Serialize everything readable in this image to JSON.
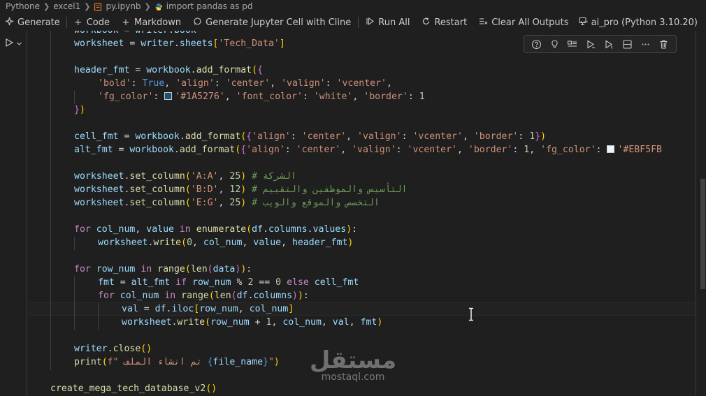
{
  "breadcrumb": {
    "items": [
      "Pythone",
      "excel1",
      "py.ipynb",
      "import pandas as pd"
    ]
  },
  "toolbar": {
    "generate": "Generate",
    "code": "Code",
    "markdown": "Markdown",
    "jupyter_cline": "Generate Jupyter Cell with Cline",
    "run_all": "Run All",
    "restart": "Restart",
    "clear_outputs": "Clear All Outputs",
    "more": "···",
    "kernel": "ai_pro (Python 3.10.20)"
  },
  "code_lines": [
    {
      "tokens": [
        {
          "t": "workbook",
          "c": "var"
        },
        {
          "t": " = ",
          "c": "op"
        },
        {
          "t": "writer",
          "c": "var"
        },
        {
          "t": ".",
          "c": "op"
        },
        {
          "t": "book",
          "c": "var"
        }
      ]
    },
    {
      "tokens": [
        {
          "t": "worksheet",
          "c": "var"
        },
        {
          "t": " = ",
          "c": "op"
        },
        {
          "t": "writer",
          "c": "var"
        },
        {
          "t": ".",
          "c": "op"
        },
        {
          "t": "sheets",
          "c": "var"
        },
        {
          "t": "[",
          "c": "p1"
        },
        {
          "t": "'Tech_Data'",
          "c": "str"
        },
        {
          "t": "]",
          "c": "p1"
        }
      ]
    },
    {
      "tokens": []
    },
    {
      "tokens": [
        {
          "t": "header_fmt",
          "c": "var"
        },
        {
          "t": " = ",
          "c": "op"
        },
        {
          "t": "workbook",
          "c": "var"
        },
        {
          "t": ".",
          "c": "op"
        },
        {
          "t": "add_format",
          "c": "fn"
        },
        {
          "t": "(",
          "c": "p1"
        },
        {
          "t": "{",
          "c": "p2"
        }
      ]
    },
    {
      "tokens": [
        {
          "t": "    ",
          "c": "plain"
        },
        {
          "t": "'bold'",
          "c": "str"
        },
        {
          "t": ": ",
          "c": "op"
        },
        {
          "t": "True",
          "c": "const"
        },
        {
          "t": ", ",
          "c": "op"
        },
        {
          "t": "'align'",
          "c": "str"
        },
        {
          "t": ": ",
          "c": "op"
        },
        {
          "t": "'center'",
          "c": "str"
        },
        {
          "t": ", ",
          "c": "op"
        },
        {
          "t": "'valign'",
          "c": "str"
        },
        {
          "t": ": ",
          "c": "op"
        },
        {
          "t": "'vcenter'",
          "c": "str"
        },
        {
          "t": ",",
          "c": "op"
        }
      ]
    },
    {
      "tokens": [
        {
          "t": "    ",
          "c": "plain"
        },
        {
          "t": "'fg_color'",
          "c": "str"
        },
        {
          "t": ": ",
          "c": "op"
        },
        {
          "t": "SWATCH1",
          "c": "swatch"
        },
        {
          "t": "'#1A5276'",
          "c": "str"
        },
        {
          "t": ", ",
          "c": "op"
        },
        {
          "t": "'font_color'",
          "c": "str"
        },
        {
          "t": ": ",
          "c": "op"
        },
        {
          "t": "'white'",
          "c": "str"
        },
        {
          "t": ", ",
          "c": "op"
        },
        {
          "t": "'border'",
          "c": "str"
        },
        {
          "t": ": ",
          "c": "op"
        },
        {
          "t": "1",
          "c": "num"
        }
      ]
    },
    {
      "tokens": [
        {
          "t": "}",
          "c": "p2"
        },
        {
          "t": ")",
          "c": "p1"
        }
      ]
    },
    {
      "tokens": []
    },
    {
      "tokens": [
        {
          "t": "cell_fmt",
          "c": "var"
        },
        {
          "t": " = ",
          "c": "op"
        },
        {
          "t": "workbook",
          "c": "var"
        },
        {
          "t": ".",
          "c": "op"
        },
        {
          "t": "add_format",
          "c": "fn"
        },
        {
          "t": "(",
          "c": "p1"
        },
        {
          "t": "{",
          "c": "p2"
        },
        {
          "t": "'align'",
          "c": "str"
        },
        {
          "t": ": ",
          "c": "op"
        },
        {
          "t": "'center'",
          "c": "str"
        },
        {
          "t": ", ",
          "c": "op"
        },
        {
          "t": "'valign'",
          "c": "str"
        },
        {
          "t": ": ",
          "c": "op"
        },
        {
          "t": "'vcenter'",
          "c": "str"
        },
        {
          "t": ", ",
          "c": "op"
        },
        {
          "t": "'border'",
          "c": "str"
        },
        {
          "t": ": ",
          "c": "op"
        },
        {
          "t": "1",
          "c": "num"
        },
        {
          "t": "}",
          "c": "p2"
        },
        {
          "t": ")",
          "c": "p1"
        }
      ]
    },
    {
      "tokens": [
        {
          "t": "alt_fmt",
          "c": "var"
        },
        {
          "t": " = ",
          "c": "op"
        },
        {
          "t": "workbook",
          "c": "var"
        },
        {
          "t": ".",
          "c": "op"
        },
        {
          "t": "add_format",
          "c": "fn"
        },
        {
          "t": "(",
          "c": "p1"
        },
        {
          "t": "{",
          "c": "p2"
        },
        {
          "t": "'align'",
          "c": "str"
        },
        {
          "t": ": ",
          "c": "op"
        },
        {
          "t": "'center'",
          "c": "str"
        },
        {
          "t": ", ",
          "c": "op"
        },
        {
          "t": "'valign'",
          "c": "str"
        },
        {
          "t": ": ",
          "c": "op"
        },
        {
          "t": "'vcenter'",
          "c": "str"
        },
        {
          "t": ", ",
          "c": "op"
        },
        {
          "t": "'border'",
          "c": "str"
        },
        {
          "t": ": ",
          "c": "op"
        },
        {
          "t": "1",
          "c": "num"
        },
        {
          "t": ", ",
          "c": "op"
        },
        {
          "t": "'fg_color'",
          "c": "str"
        },
        {
          "t": ": ",
          "c": "op"
        },
        {
          "t": "SWATCH2",
          "c": "swatch"
        },
        {
          "t": "'#EBF5FB",
          "c": "str"
        }
      ]
    },
    {
      "tokens": []
    },
    {
      "tokens": [
        {
          "t": "worksheet",
          "c": "var"
        },
        {
          "t": ".",
          "c": "op"
        },
        {
          "t": "set_column",
          "c": "fn"
        },
        {
          "t": "(",
          "c": "p1"
        },
        {
          "t": "'A:A'",
          "c": "str"
        },
        {
          "t": ", ",
          "c": "op"
        },
        {
          "t": "25",
          "c": "num"
        },
        {
          "t": ")",
          "c": "p1"
        },
        {
          "t": " # الشركة",
          "c": "cmt"
        }
      ]
    },
    {
      "tokens": [
        {
          "t": "worksheet",
          "c": "var"
        },
        {
          "t": ".",
          "c": "op"
        },
        {
          "t": "set_column",
          "c": "fn"
        },
        {
          "t": "(",
          "c": "p1"
        },
        {
          "t": "'B:D'",
          "c": "str"
        },
        {
          "t": ", ",
          "c": "op"
        },
        {
          "t": "12",
          "c": "num"
        },
        {
          "t": ")",
          "c": "p1"
        },
        {
          "t": " # التأسيس والموظفين والتقييم",
          "c": "cmt"
        }
      ]
    },
    {
      "tokens": [
        {
          "t": "worksheet",
          "c": "var"
        },
        {
          "t": ".",
          "c": "op"
        },
        {
          "t": "set_column",
          "c": "fn"
        },
        {
          "t": "(",
          "c": "p1"
        },
        {
          "t": "'E:G'",
          "c": "str"
        },
        {
          "t": ", ",
          "c": "op"
        },
        {
          "t": "25",
          "c": "num"
        },
        {
          "t": ")",
          "c": "p1"
        },
        {
          "t": " # التخصص والموقع والويب",
          "c": "cmt"
        }
      ]
    },
    {
      "tokens": []
    },
    {
      "tokens": [
        {
          "t": "for",
          "c": "kw"
        },
        {
          "t": " ",
          "c": "op"
        },
        {
          "t": "col_num",
          "c": "var"
        },
        {
          "t": ", ",
          "c": "op"
        },
        {
          "t": "value",
          "c": "var"
        },
        {
          "t": " ",
          "c": "op"
        },
        {
          "t": "in",
          "c": "kw"
        },
        {
          "t": " ",
          "c": "op"
        },
        {
          "t": "enumerate",
          "c": "fn"
        },
        {
          "t": "(",
          "c": "p1"
        },
        {
          "t": "df",
          "c": "var"
        },
        {
          "t": ".",
          "c": "op"
        },
        {
          "t": "columns",
          "c": "var"
        },
        {
          "t": ".",
          "c": "op"
        },
        {
          "t": "values",
          "c": "var"
        },
        {
          "t": ")",
          "c": "p1"
        },
        {
          "t": ":",
          "c": "op"
        }
      ]
    },
    {
      "tokens": [
        {
          "t": "    ",
          "c": "plain"
        },
        {
          "t": "worksheet",
          "c": "var"
        },
        {
          "t": ".",
          "c": "op"
        },
        {
          "t": "write",
          "c": "fn"
        },
        {
          "t": "(",
          "c": "p1"
        },
        {
          "t": "0",
          "c": "num"
        },
        {
          "t": ", ",
          "c": "op"
        },
        {
          "t": "col_num",
          "c": "var"
        },
        {
          "t": ", ",
          "c": "op"
        },
        {
          "t": "value",
          "c": "var"
        },
        {
          "t": ", ",
          "c": "op"
        },
        {
          "t": "header_fmt",
          "c": "var"
        },
        {
          "t": ")",
          "c": "p1"
        }
      ]
    },
    {
      "tokens": []
    },
    {
      "tokens": [
        {
          "t": "for",
          "c": "kw"
        },
        {
          "t": " ",
          "c": "op"
        },
        {
          "t": "row_num",
          "c": "var"
        },
        {
          "t": " ",
          "c": "op"
        },
        {
          "t": "in",
          "c": "kw"
        },
        {
          "t": " ",
          "c": "op"
        },
        {
          "t": "range",
          "c": "fn"
        },
        {
          "t": "(",
          "c": "p1"
        },
        {
          "t": "len",
          "c": "fn"
        },
        {
          "t": "(",
          "c": "p2"
        },
        {
          "t": "data",
          "c": "var"
        },
        {
          "t": ")",
          "c": "p2"
        },
        {
          "t": ")",
          "c": "p1"
        },
        {
          "t": ":",
          "c": "op"
        }
      ]
    },
    {
      "tokens": [
        {
          "t": "    ",
          "c": "plain"
        },
        {
          "t": "fmt",
          "c": "var"
        },
        {
          "t": " = ",
          "c": "op"
        },
        {
          "t": "alt_fmt",
          "c": "var"
        },
        {
          "t": " ",
          "c": "op"
        },
        {
          "t": "if",
          "c": "kw"
        },
        {
          "t": " ",
          "c": "op"
        },
        {
          "t": "row_num",
          "c": "var"
        },
        {
          "t": " % ",
          "c": "op"
        },
        {
          "t": "2",
          "c": "num"
        },
        {
          "t": " == ",
          "c": "op"
        },
        {
          "t": "0",
          "c": "num"
        },
        {
          "t": " ",
          "c": "op"
        },
        {
          "t": "else",
          "c": "kw"
        },
        {
          "t": " ",
          "c": "op"
        },
        {
          "t": "cell_fmt",
          "c": "var"
        }
      ]
    },
    {
      "tokens": [
        {
          "t": "    ",
          "c": "plain"
        },
        {
          "t": "for",
          "c": "kw"
        },
        {
          "t": " ",
          "c": "op"
        },
        {
          "t": "col_num",
          "c": "var"
        },
        {
          "t": " ",
          "c": "op"
        },
        {
          "t": "in",
          "c": "kw"
        },
        {
          "t": " ",
          "c": "op"
        },
        {
          "t": "range",
          "c": "fn"
        },
        {
          "t": "(",
          "c": "p1"
        },
        {
          "t": "len",
          "c": "fn"
        },
        {
          "t": "(",
          "c": "p2"
        },
        {
          "t": "df",
          "c": "var"
        },
        {
          "t": ".",
          "c": "op"
        },
        {
          "t": "columns",
          "c": "var"
        },
        {
          "t": ")",
          "c": "p2"
        },
        {
          "t": ")",
          "c": "p1"
        },
        {
          "t": ":",
          "c": "op"
        }
      ]
    },
    {
      "tokens": [
        {
          "t": "        ",
          "c": "plain"
        },
        {
          "t": "val",
          "c": "var"
        },
        {
          "t": " = ",
          "c": "op"
        },
        {
          "t": "df",
          "c": "var"
        },
        {
          "t": ".",
          "c": "op"
        },
        {
          "t": "iloc",
          "c": "var"
        },
        {
          "t": "[",
          "c": "p1"
        },
        {
          "t": "row_num",
          "c": "var"
        },
        {
          "t": ", ",
          "c": "op"
        },
        {
          "t": "col_num",
          "c": "var"
        },
        {
          "t": "]",
          "c": "p1"
        }
      ]
    },
    {
      "tokens": [
        {
          "t": "        ",
          "c": "plain"
        },
        {
          "t": "worksheet",
          "c": "var"
        },
        {
          "t": ".",
          "c": "op"
        },
        {
          "t": "write",
          "c": "fn"
        },
        {
          "t": "(",
          "c": "p1"
        },
        {
          "t": "row_num",
          "c": "var"
        },
        {
          "t": " + ",
          "c": "op"
        },
        {
          "t": "1",
          "c": "num"
        },
        {
          "t": ", ",
          "c": "op"
        },
        {
          "t": "col_num",
          "c": "var"
        },
        {
          "t": ", ",
          "c": "op"
        },
        {
          "t": "val",
          "c": "var"
        },
        {
          "t": ", ",
          "c": "op"
        },
        {
          "t": "fmt",
          "c": "var"
        },
        {
          "t": ")",
          "c": "p1"
        }
      ]
    },
    {
      "tokens": []
    },
    {
      "tokens": [
        {
          "t": "writer",
          "c": "var"
        },
        {
          "t": ".",
          "c": "op"
        },
        {
          "t": "close",
          "c": "fn"
        },
        {
          "t": "()",
          "c": "p1"
        }
      ]
    },
    {
      "tokens": [
        {
          "t": "print",
          "c": "fn"
        },
        {
          "t": "(",
          "c": "p1"
        },
        {
          "t": "f\" تم انشاء الملف ",
          "c": "str"
        },
        {
          "t": "{",
          "c": "const"
        },
        {
          "t": "file_name",
          "c": "var"
        },
        {
          "t": "}",
          "c": "const"
        },
        {
          "t": "\"",
          "c": "str"
        },
        {
          "t": ")",
          "c": "p1"
        }
      ]
    },
    {
      "tokens": []
    },
    {
      "tokens": [
        {
          "t": "create_mega_tech_database_v2",
          "c": "fn"
        },
        {
          "t": "()",
          "c": "p1"
        }
      ]
    }
  ],
  "swatches": {
    "SWATCH1": "#1A5276",
    "SWATCH2": "#EBF5FB"
  },
  "watermark": {
    "arabic": "مستقل",
    "latin": "mostaql.com"
  },
  "cell_toolbar_icons": [
    "help-icon",
    "lightbulb-icon",
    "variables-icon",
    "run-above-icon",
    "run-below-icon",
    "split-cell-icon",
    "more-icon",
    "delete-icon"
  ]
}
